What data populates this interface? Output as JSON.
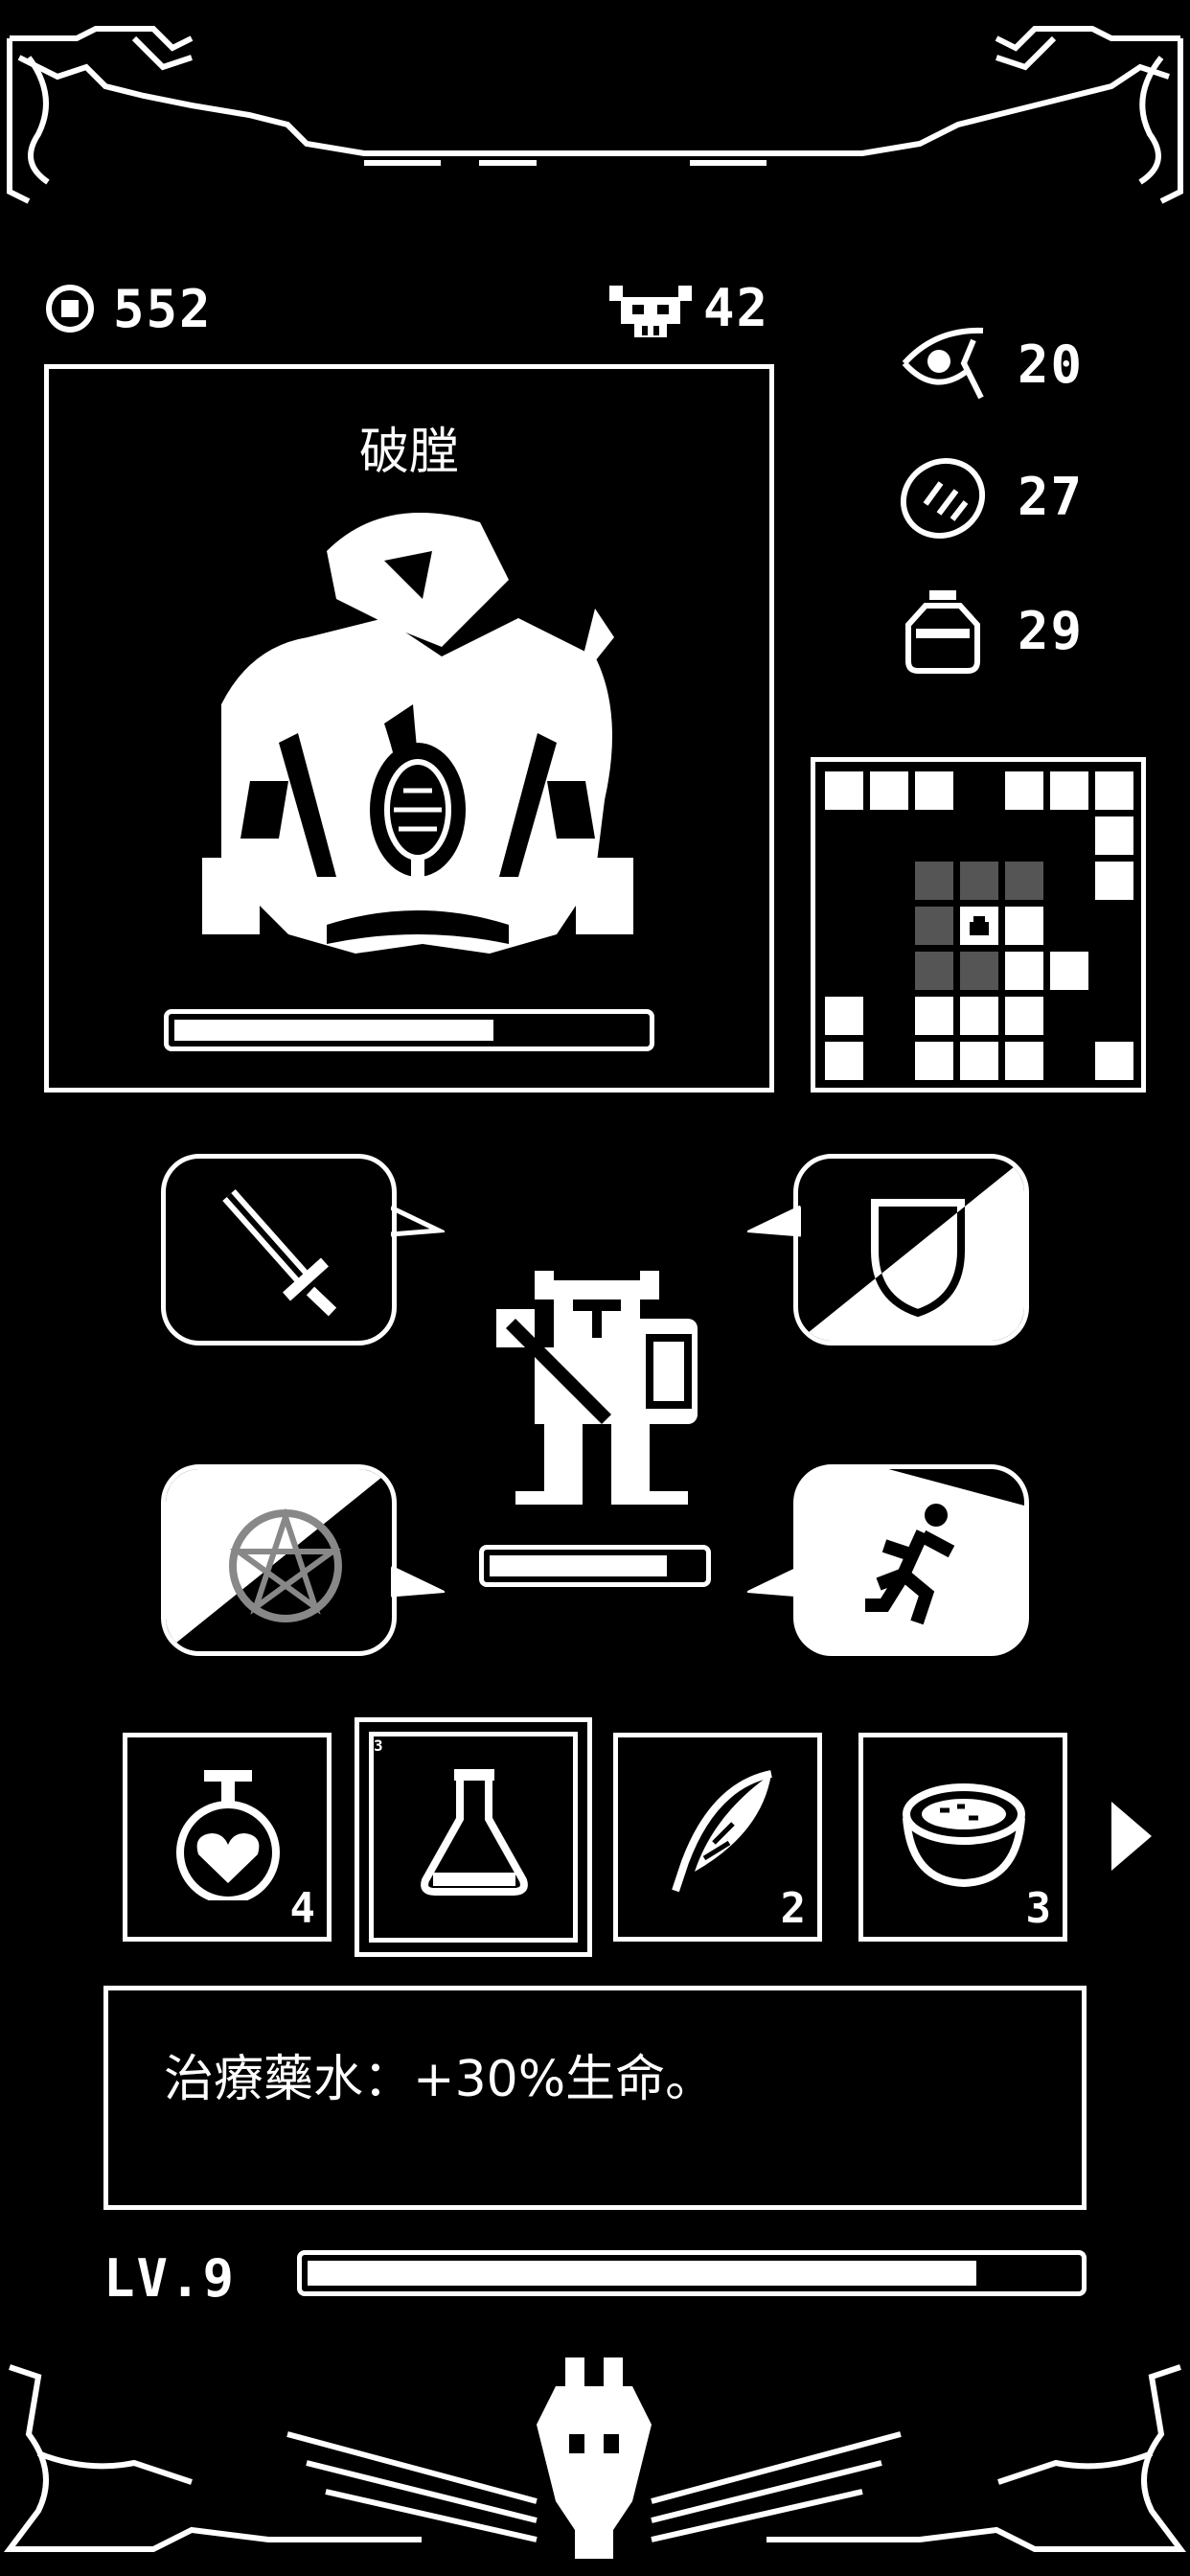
{
  "colors": {
    "background": "#000000",
    "foreground": "#ffffff",
    "map_visited": "#555555"
  },
  "currency": {
    "icon": "coin-icon",
    "value": "552"
  },
  "kills": {
    "icon": "skull-icon",
    "value": "42"
  },
  "stats": [
    {
      "icon": "eye-icon",
      "value": "20"
    },
    {
      "icon": "bread-icon",
      "value": "27"
    },
    {
      "icon": "bag-icon",
      "value": "29"
    }
  ],
  "enemy": {
    "name": "破膛",
    "health": 0.68
  },
  "minimap": {
    "rows": [
      "WWW.WWW",
      "......W",
      "..GGG.W",
      "..GPW..",
      "..GGWW.",
      "W.WWW..",
      "W.WWW.W"
    ]
  },
  "player": {
    "health": 0.84
  },
  "actions": [
    {
      "name": "attack",
      "icon": "sword-icon",
      "cooldown": 0
    },
    {
      "name": "defend",
      "icon": "shield-icon",
      "cooldown": 0.5
    },
    {
      "name": "magic",
      "icon": "pentagram-icon",
      "cooldown": 0.5
    },
    {
      "name": "flee",
      "icon": "run-icon",
      "cooldown": 0.5
    }
  ],
  "inventory": [
    {
      "icon": "heart-potion-icon",
      "count": "4"
    },
    {
      "icon": "flask-icon",
      "count": "3",
      "selected": true
    },
    {
      "icon": "feather-icon",
      "count": "2"
    },
    {
      "icon": "bowl-icon",
      "count": "3"
    }
  ],
  "item_description": "治療藥水：+30%生命。",
  "level": {
    "label": "LV.9",
    "progress": 0.87
  }
}
